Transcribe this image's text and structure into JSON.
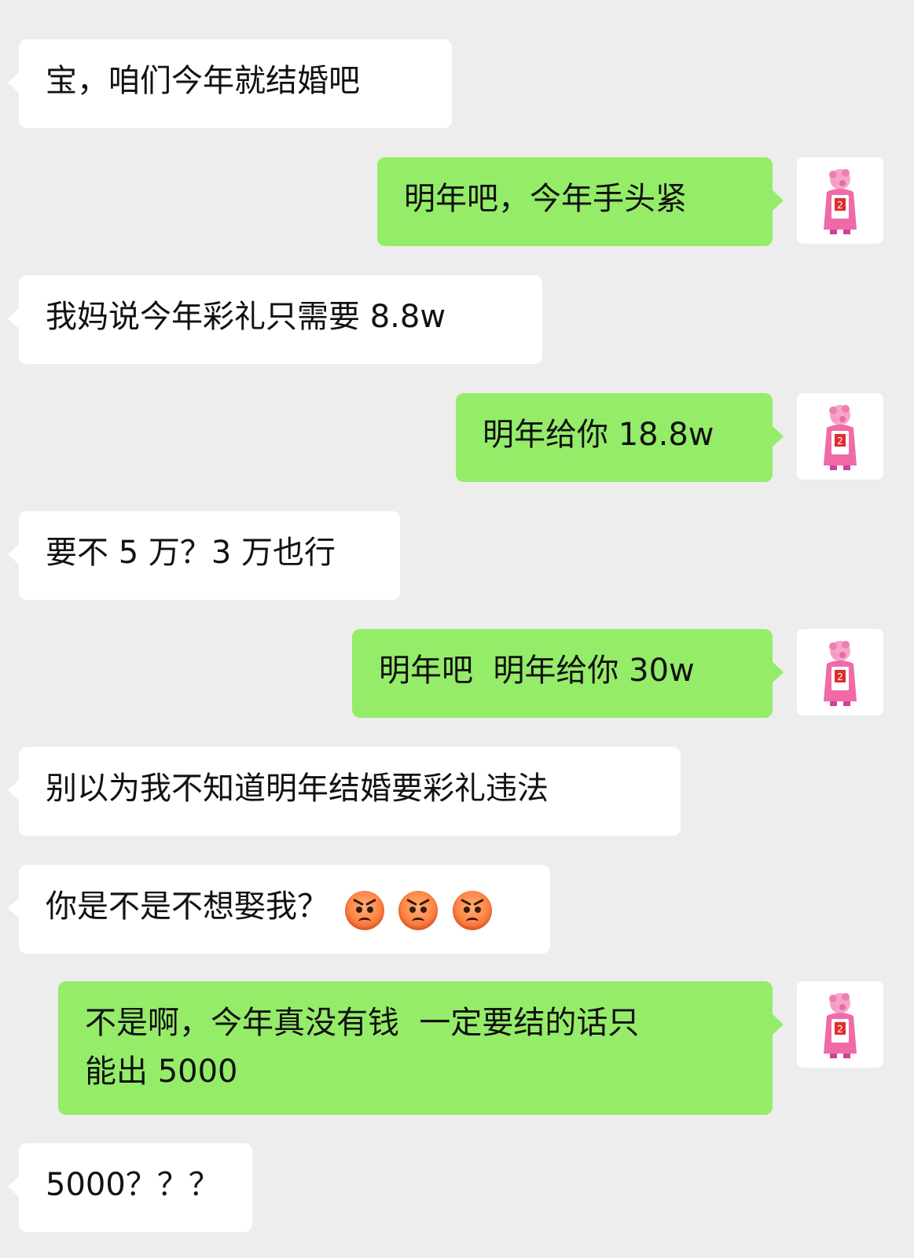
{
  "messages": [
    {
      "side": "in",
      "text": "宝，咱们今年就结婚吧"
    },
    {
      "side": "out",
      "text": "明年吧，今年手头紧"
    },
    {
      "side": "in",
      "text": "我妈说今年彩礼只需要 8.8w"
    },
    {
      "side": "out",
      "text": "明年给你 18.8w"
    },
    {
      "side": "in",
      "text": "要不 5 万？3 万也行"
    },
    {
      "side": "out",
      "text": "明年吧  明年给你 30w"
    },
    {
      "side": "in",
      "text": "别以为我不知道明年结婚要彩礼违法"
    },
    {
      "side": "in",
      "text": "你是不是不想娶我？",
      "emoji": [
        "angry-face",
        "angry-face",
        "angry-face"
      ]
    },
    {
      "side": "out",
      "text_line1": "不是啊，今年真没有钱  一定要结的话只",
      "text_line2": "能出 5000"
    },
    {
      "side": "in",
      "text": "5000？？？"
    }
  ],
  "avatar": {
    "icon": "pink-hoodie-avatar-icon",
    "badge_text": "2",
    "colors": {
      "hoodie": "#f06aa8",
      "flowers": "#f7a6c9",
      "badge": "#e02d2d"
    }
  },
  "colors": {
    "background": "#ededed",
    "incoming_bubble": "#ffffff",
    "outgoing_bubble": "#95ec69"
  }
}
